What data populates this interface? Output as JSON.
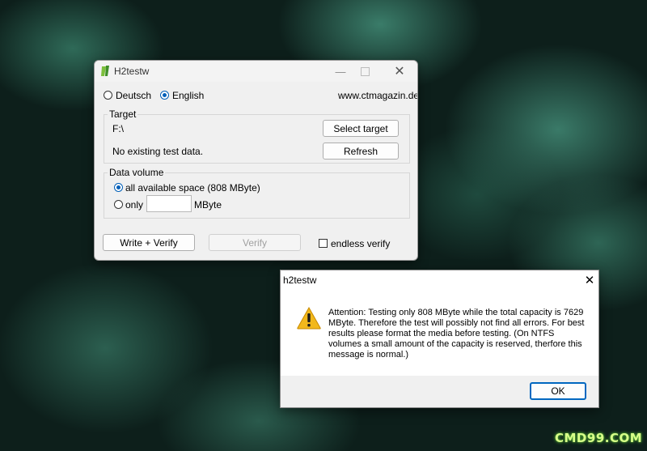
{
  "main_window": {
    "title": "H2testw",
    "lang_deutsch": "Deutsch",
    "lang_english": "English",
    "website": "www.ctmagazin.de",
    "target": {
      "group_label": "Target",
      "path": "F:\\",
      "status": "No existing test data.",
      "select_button": "Select target",
      "refresh_button": "Refresh"
    },
    "data_volume": {
      "group_label": "Data volume",
      "all_space_label": "all available space (808 MByte)",
      "only_label": "only",
      "only_value": "",
      "unit": "MByte"
    },
    "buttons": {
      "write_verify": "Write + Verify",
      "verify": "Verify",
      "endless_verify": "endless verify"
    },
    "selected_language": "English",
    "selected_volume": "all"
  },
  "dialog": {
    "title": "h2testw",
    "close_glyph": "✕",
    "message": "Attention: Testing only 808 MByte while the total capacity is 7629 MByte. Therefore the test will possibly not find all errors. For best results please format the media before testing. (On NTFS volumes a small amount of the capacity is reserved, therfore this message is normal.)",
    "ok_button": "OK"
  },
  "watermark": "CMD99.COM"
}
